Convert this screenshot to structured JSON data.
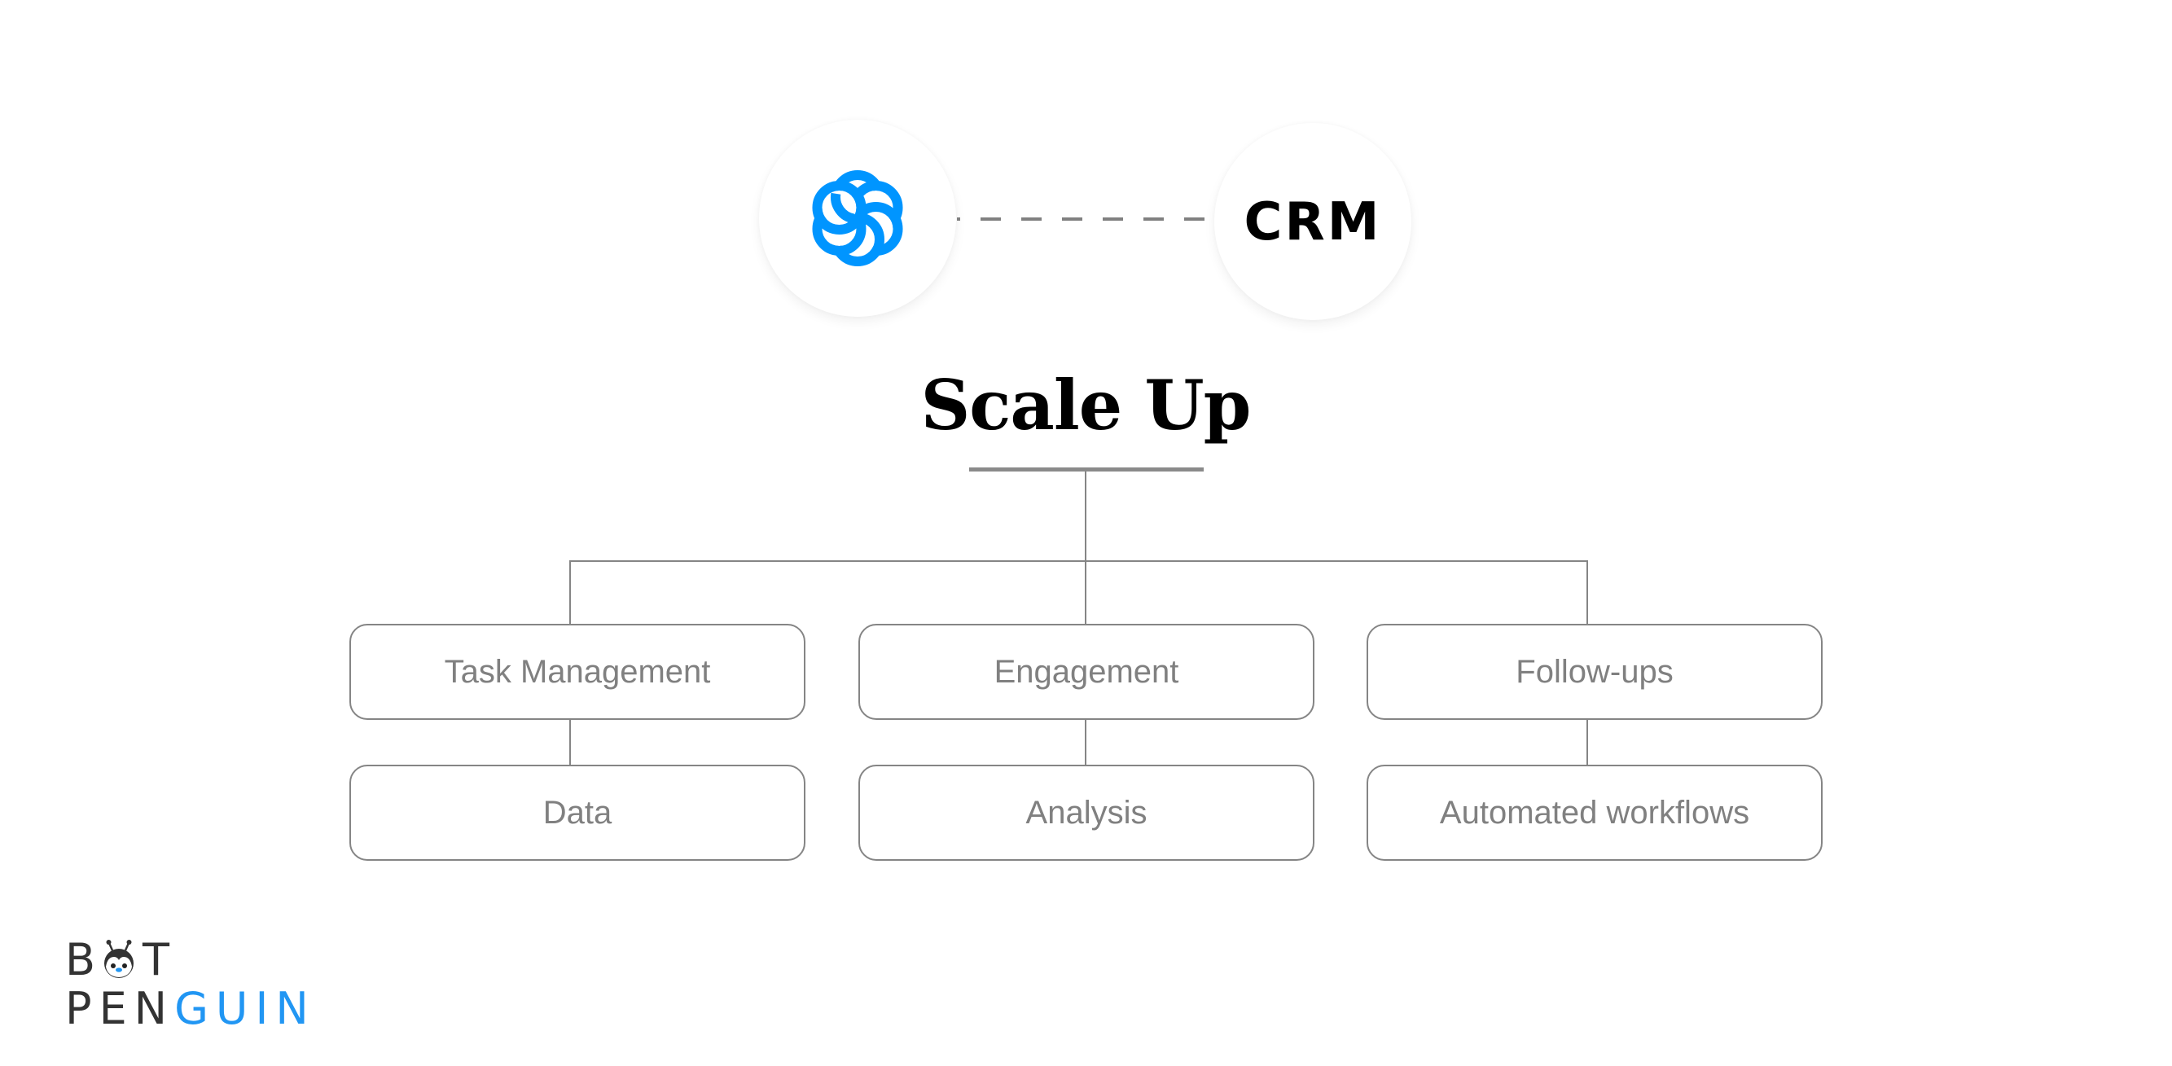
{
  "integration": {
    "left_logo": {
      "icon": "sendinblue-swirl-icon",
      "color": "#0095ff"
    },
    "right_label": "CRM",
    "connector_color": "#808080"
  },
  "title": "Scale Up",
  "tree": {
    "line_color": "#858585",
    "columns": [
      {
        "primary": "Task Management",
        "secondary": "Data"
      },
      {
        "primary": "Engagement",
        "secondary": "Analysis"
      },
      {
        "primary": "Follow-ups",
        "secondary": "Automated workflows"
      }
    ]
  },
  "brand": {
    "line1_prefix": "B",
    "line1_icon": "penguin-head-icon",
    "line1_suffix": "T",
    "line2_dark": "PEN",
    "line2_blue": "GUIN",
    "blue_color": "#2196f3",
    "dark_color": "#333333"
  }
}
